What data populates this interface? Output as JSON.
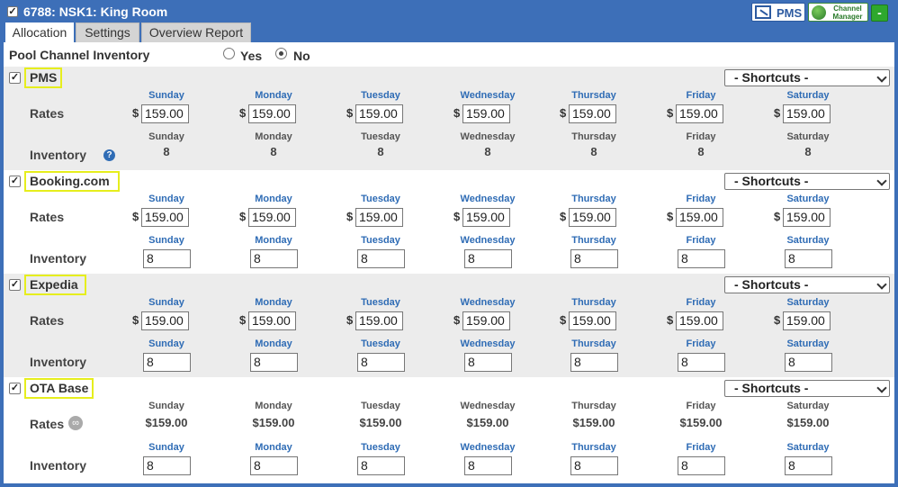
{
  "window": {
    "title": "6788: NSK1: King Room",
    "pms_label": "PMS",
    "channel_manager_label": "Channel Manager",
    "collapse_label": "-"
  },
  "tabs": [
    {
      "label": "Allocation"
    },
    {
      "label": "Settings"
    },
    {
      "label": "Overview Report"
    }
  ],
  "pool": {
    "label": "Pool Channel Inventory",
    "yes": "Yes",
    "no": "No",
    "selected": "No"
  },
  "days": [
    "Sunday",
    "Monday",
    "Tuesday",
    "Wednesday",
    "Thursday",
    "Friday",
    "Saturday"
  ],
  "labels": {
    "rates": "Rates",
    "inventory": "Inventory",
    "shortcuts": "- Shortcuts -",
    "currency": "$"
  },
  "sections": [
    {
      "name": "PMS",
      "checked": true,
      "rates": [
        "159.00",
        "159.00",
        "159.00",
        "159.00",
        "159.00",
        "159.00",
        "159.00"
      ],
      "inventory": [
        "8",
        "8",
        "8",
        "8",
        "8",
        "8",
        "8"
      ]
    },
    {
      "name": "Booking.com",
      "checked": true,
      "rates": [
        "159.00",
        "159.00",
        "159.00",
        "159.00",
        "159.00",
        "159.00",
        "159.00"
      ],
      "inventory": [
        "8",
        "8",
        "8",
        "8",
        "8",
        "8",
        "8"
      ]
    },
    {
      "name": "Expedia",
      "checked": true,
      "rates": [
        "159.00",
        "159.00",
        "159.00",
        "159.00",
        "159.00",
        "159.00",
        "159.00"
      ],
      "inventory": [
        "8",
        "8",
        "8",
        "8",
        "8",
        "8",
        "8"
      ]
    },
    {
      "name": "OTA Base",
      "checked": true,
      "rates": [
        "$159.00",
        "$159.00",
        "$159.00",
        "$159.00",
        "$159.00",
        "$159.00",
        "$159.00"
      ],
      "inventory": [
        "8",
        "8",
        "8",
        "8",
        "8",
        "8",
        "8"
      ]
    }
  ],
  "colors": {
    "frame": "#3d6fb8",
    "highlight": "#e6ee1d",
    "day_blue": "#2f6cb5",
    "section_grey": "#ececec"
  },
  "icons": {
    "help": "question-icon",
    "link": "link-icon",
    "pms": "network-icon",
    "channel_manager": "globe-icon"
  }
}
